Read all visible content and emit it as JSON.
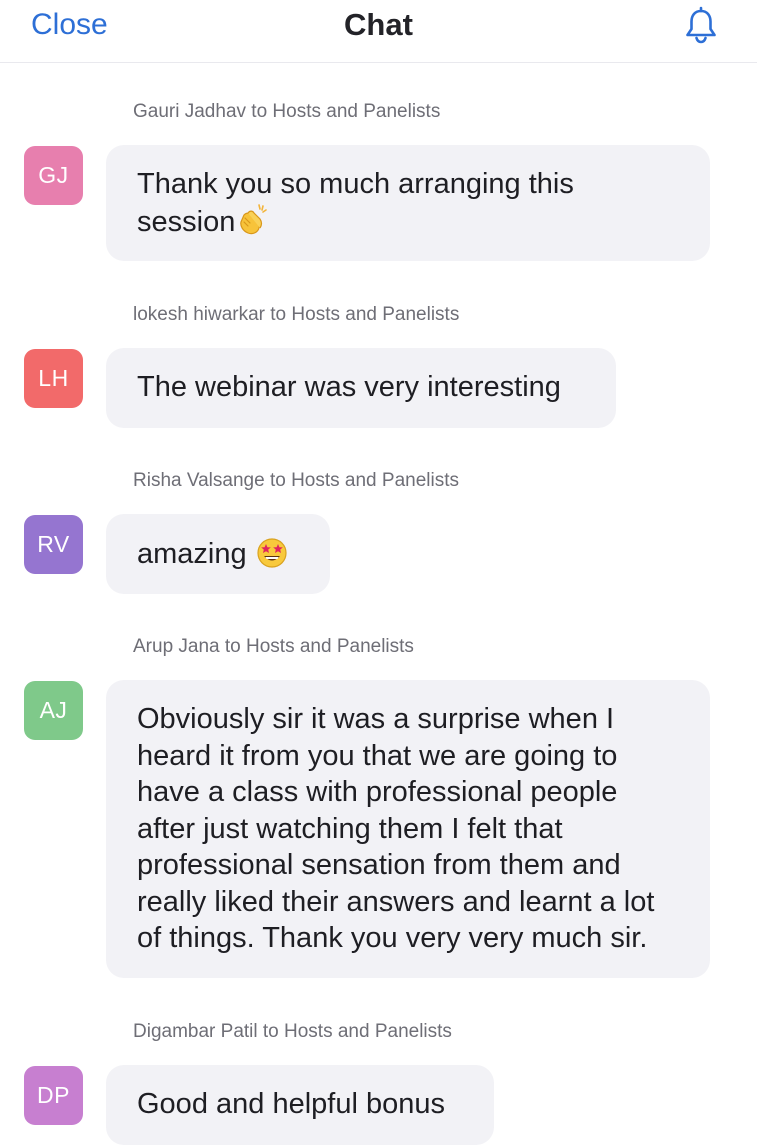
{
  "header": {
    "close_label": "Close",
    "title": "Chat",
    "bell_icon": "bell-icon"
  },
  "colors": {
    "accent": "#2d6fd6",
    "bubble_bg": "#f2f2f6",
    "avatar_gj": "#e77fae",
    "avatar_lh": "#f26a6a",
    "avatar_rv": "#9575d0",
    "avatar_aj": "#7fc98a",
    "avatar_dp": "#c77fd0"
  },
  "messages": [
    {
      "sender_line": "Gauri Jadhav to Hosts and Panelists",
      "initials": "GJ",
      "text": "Thank you so much arranging this session",
      "emoji": "clapping-hands-emoji"
    },
    {
      "sender_line": "lokesh hiwarkar to Hosts and Panelists",
      "initials": "LH",
      "text": "The webinar was very interesting"
    },
    {
      "sender_line": "Risha Valsange to Hosts and Panelists",
      "initials": "RV",
      "text": "amazing",
      "emoji": "star-struck-emoji"
    },
    {
      "sender_line": "Arup Jana to Hosts and Panelists",
      "initials": "AJ",
      "text": "Obviously sir it was a surprise when I heard it from you that we are going to have a class with professional people after just watching them I felt that professional sensation from them and really liked their answers and learnt a lot of things. Thank you very very much sir."
    },
    {
      "sender_line": "Digambar Patil to Hosts and Panelists",
      "initials": "DP",
      "text": "Good and helpful bonus"
    }
  ]
}
